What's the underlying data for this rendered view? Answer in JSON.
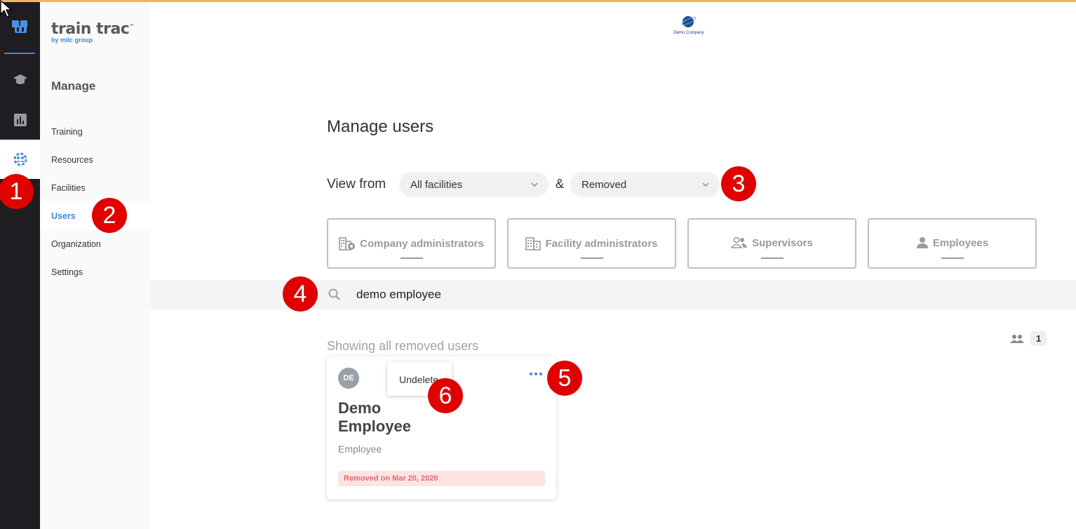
{
  "brand": {
    "name": "train trac",
    "tm": "™",
    "sub": "by milc group"
  },
  "company": {
    "name": "Demo Company"
  },
  "nav": {
    "title": "Manage",
    "items": [
      {
        "label": "Training"
      },
      {
        "label": "Resources"
      },
      {
        "label": "Facilities"
      },
      {
        "label": "Users"
      },
      {
        "label": "Organization"
      },
      {
        "label": "Settings"
      }
    ]
  },
  "page": {
    "title": "Manage users",
    "view_from_label": "View from",
    "amp": "&",
    "facility_select": "All facilities",
    "status_select": "Removed"
  },
  "role_tabs": [
    {
      "label": "Company administrators",
      "icon": "company-admin-icon"
    },
    {
      "label": "Facility administrators",
      "icon": "building-icon"
    },
    {
      "label": "Supervisors",
      "icon": "supervisors-icon"
    },
    {
      "label": "Employees",
      "icon": "person-icon"
    }
  ],
  "search": {
    "value": "demo employee"
  },
  "results": {
    "showing": "Showing all removed users",
    "count": "1"
  },
  "user_card": {
    "initials": "DE",
    "name": "Demo Employee",
    "role": "Employee",
    "removed_note": "Removed on Mar 20, 2020"
  },
  "popup": {
    "undelete": "Undelete"
  },
  "callouts": [
    "1",
    "2",
    "3",
    "4",
    "5",
    "6"
  ],
  "colors": {
    "accent": "#3f86d4",
    "callout": "#e00000",
    "rail": "#1f1d21",
    "top_line": "#f2b65a"
  }
}
